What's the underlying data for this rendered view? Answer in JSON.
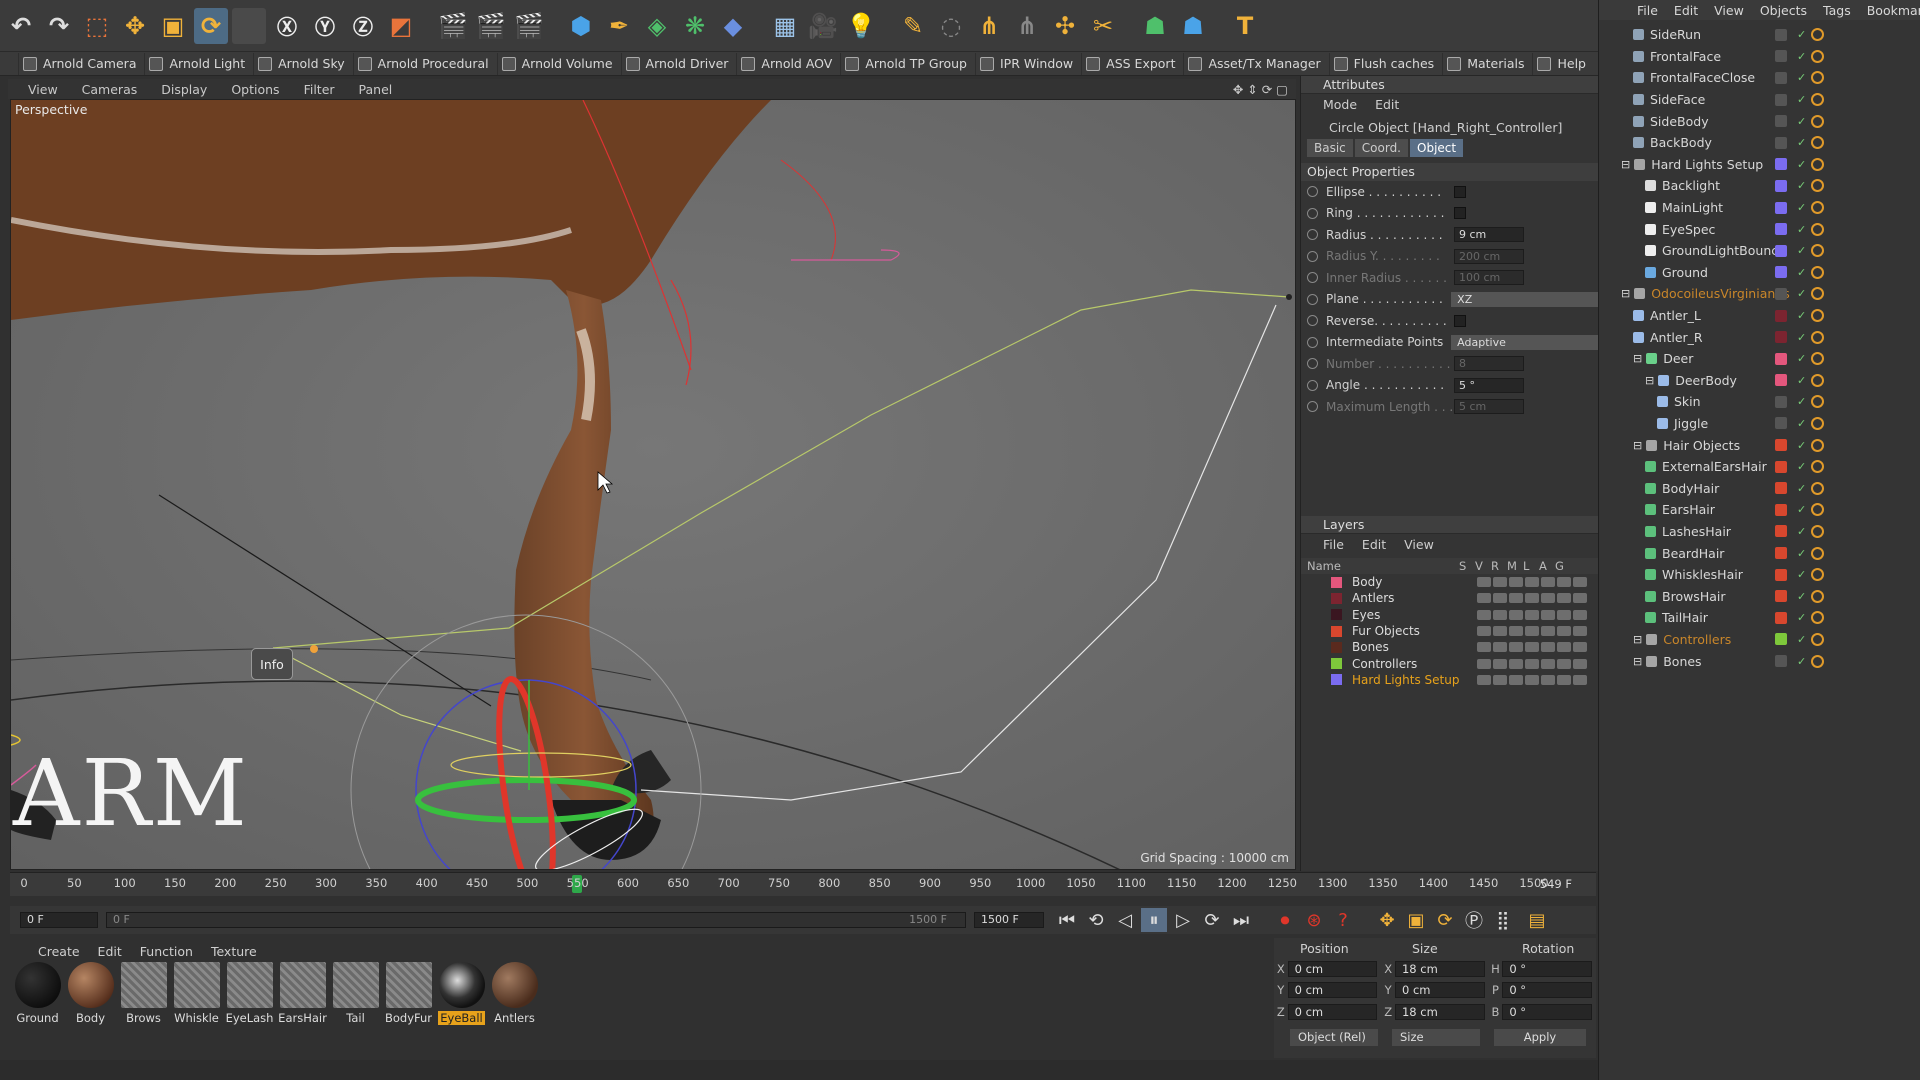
{
  "toolbar2": [
    "Arnold Camera",
    "Arnold Light",
    "Arnold Sky",
    "Arnold Procedural",
    "Arnold Volume",
    "Arnold Driver",
    "Arnold AOV",
    "Arnold TP Group",
    "IPR Window",
    "ASS Export",
    "Asset/Tx Manager",
    "Flush caches",
    "Materials",
    "Help"
  ],
  "viewport": {
    "menu": [
      "View",
      "Cameras",
      "Display",
      "Options",
      "Filter",
      "Panel"
    ],
    "label": "Perspective",
    "grid": "Grid Spacing : 10000 cm",
    "info": "Info",
    "watermark": "ARM"
  },
  "attributes": {
    "title": "Attributes",
    "menu": [
      "Mode",
      "Edit"
    ],
    "object": "Circle Object [Hand_Right_Controller]",
    "tabs": [
      "Basic",
      "Coord.",
      "Object"
    ],
    "section": "Object Properties",
    "props": [
      {
        "label": "Ellipse . . . . . . . . . .",
        "kind": "cb"
      },
      {
        "label": "Ring . . . . . . . . . . . .",
        "kind": "cb"
      },
      {
        "label": "Radius . . . . . . . . . .",
        "kind": "val",
        "value": "9 cm"
      },
      {
        "label": "Radius Y. . . . . . . . .",
        "kind": "val",
        "value": "200 cm",
        "dim": true
      },
      {
        "label": "Inner Radius . . . . . .",
        "kind": "val",
        "value": "100 cm",
        "dim": true
      },
      {
        "label": "Plane . . . . . . . . . . .",
        "kind": "sel",
        "value": "XZ"
      },
      {
        "label": "Reverse. . . . . . . . . .",
        "kind": "cb"
      },
      {
        "label": "Intermediate Points",
        "kind": "sel",
        "value": "Adaptive"
      },
      {
        "label": "Number . . . . . . . . . .",
        "kind": "val",
        "value": "8",
        "dim": true
      },
      {
        "label": "Angle . . . . . . . . . . .",
        "kind": "val",
        "value": "5 °"
      },
      {
        "label": "Maximum Length . . .",
        "kind": "val",
        "value": "5 cm",
        "dim": true
      }
    ]
  },
  "layers": {
    "title": "Layers",
    "menu": [
      "File",
      "Edit",
      "View"
    ],
    "cols": [
      "Name",
      "S",
      "V",
      "R",
      "M",
      "L",
      "A",
      "G"
    ],
    "rows": [
      {
        "name": "Body",
        "color": "#e4577d"
      },
      {
        "name": "Antlers",
        "color": "#7c2430"
      },
      {
        "name": "Eyes",
        "color": "#3a1620"
      },
      {
        "name": "Fur Objects",
        "color": "#d8472e"
      },
      {
        "name": "Bones",
        "color": "#5a2a1e"
      },
      {
        "name": "Controllers",
        "color": "#7ec83b"
      },
      {
        "name": "Hard Lights Setup",
        "color": "#7b6cf0",
        "sel": true
      }
    ]
  },
  "objects": {
    "menu": [
      "File",
      "Edit",
      "View",
      "Objects",
      "Tags",
      "Bookmarks"
    ],
    "rows": [
      {
        "name": "SideRun",
        "indent": 1,
        "c": "#8fa3b7"
      },
      {
        "name": "FrontalFace",
        "indent": 1,
        "c": "#8fa3b7"
      },
      {
        "name": "FrontalFaceClose",
        "indent": 1,
        "c": "#8fa3b7"
      },
      {
        "name": "SideFace",
        "indent": 1,
        "c": "#8fa3b7"
      },
      {
        "name": "SideBody",
        "indent": 1,
        "c": "#8fa3b7"
      },
      {
        "name": "BackBody",
        "indent": 1,
        "c": "#8fa3b7"
      },
      {
        "name": "Hard Lights Setup",
        "indent": 0,
        "c": "#a5a5a5",
        "g": "#7b6cf0"
      },
      {
        "name": "Backlight",
        "indent": 2,
        "c": "#ddd",
        "g": "#7b6cf0"
      },
      {
        "name": "MainLight",
        "indent": 2,
        "c": "#eee",
        "g": "#7b6cf0"
      },
      {
        "name": "EyeSpec",
        "indent": 2,
        "c": "#eee",
        "g": "#7b6cf0"
      },
      {
        "name": "GroundLightBounce",
        "indent": 2,
        "c": "#eee",
        "g": "#7b6cf0"
      },
      {
        "name": "Ground",
        "indent": 2,
        "c": "#6aa9e0",
        "g": "#7b6cf0"
      },
      {
        "name": "OdocoileusVirginianus",
        "indent": 0,
        "c": "#a5a5a5",
        "orange": true
      },
      {
        "name": "Antler_L",
        "indent": 1,
        "c": "#9bbbe8",
        "g": "#7c2430"
      },
      {
        "name": "Antler_R",
        "indent": 1,
        "c": "#9bbbe8",
        "g": "#7c2430"
      },
      {
        "name": "Deer",
        "indent": 1,
        "c": "#6ad08a",
        "g": "#e4577d"
      },
      {
        "name": "DeerBody",
        "indent": 2,
        "c": "#9bbbe8",
        "g": "#e4577d"
      },
      {
        "name": "Skin",
        "indent": 3,
        "c": "#9bbbe8"
      },
      {
        "name": "Jiggle",
        "indent": 3,
        "c": "#9bbbe8"
      },
      {
        "name": "Hair Objects",
        "indent": 1,
        "c": "#a5a5a5",
        "g": "#d8472e"
      },
      {
        "name": "ExternalEarsHair",
        "indent": 2,
        "c": "#5cc07c",
        "g": "#d8472e"
      },
      {
        "name": "BodyHair",
        "indent": 2,
        "c": "#5cc07c",
        "g": "#d8472e"
      },
      {
        "name": "EarsHair",
        "indent": 2,
        "c": "#5cc07c",
        "g": "#d8472e"
      },
      {
        "name": "LashesHair",
        "indent": 2,
        "c": "#5cc07c",
        "g": "#d8472e"
      },
      {
        "name": "BeardHair",
        "indent": 2,
        "c": "#5cc07c",
        "g": "#d8472e"
      },
      {
        "name": "WhisklesHair",
        "indent": 2,
        "c": "#5cc07c",
        "g": "#d8472e"
      },
      {
        "name": "BrowsHair",
        "indent": 2,
        "c": "#5cc07c",
        "g": "#d8472e"
      },
      {
        "name": "TailHair",
        "indent": 2,
        "c": "#5cc07c",
        "g": "#d8472e"
      },
      {
        "name": "Controllers",
        "indent": 1,
        "c": "#a5a5a5",
        "g": "#7ec83b",
        "orange": true
      },
      {
        "name": "Bones",
        "indent": 1,
        "c": "#a5a5a5"
      }
    ]
  },
  "timeline": {
    "ticks": [
      "0",
      "50",
      "100",
      "150",
      "200",
      "250",
      "300",
      "350",
      "400",
      "450",
      "500",
      "550",
      "600",
      "650",
      "700",
      "750",
      "800",
      "850",
      "900",
      "950",
      "1000",
      "1050",
      "1100",
      "1150",
      "1200",
      "1250",
      "1300",
      "1350",
      "1400",
      "1450",
      "1500"
    ],
    "current": "549 F",
    "start": "0 F",
    "range_start": "0 F",
    "range_end": "1500 F",
    "end": "1500 F"
  },
  "materials": {
    "menu": [
      "Create",
      "Edit",
      "Function",
      "Texture"
    ],
    "items": [
      {
        "name": "Ground",
        "type": "black"
      },
      {
        "name": "Body",
        "type": "brown"
      },
      {
        "name": "Brows",
        "type": "stripe"
      },
      {
        "name": "Whiskle",
        "type": "stripe"
      },
      {
        "name": "EyeLash",
        "type": "stripe"
      },
      {
        "name": "EarsHair",
        "type": "stripe"
      },
      {
        "name": "Tail",
        "type": "stripe"
      },
      {
        "name": "BodyFur",
        "type": "stripe"
      },
      {
        "name": "EyeBall",
        "type": "eye",
        "sel": true
      },
      {
        "name": "Antlers",
        "type": "antler"
      }
    ]
  },
  "coords": {
    "headers": [
      "Position",
      "Size",
      "Rotation"
    ],
    "rows": [
      {
        "a": "X",
        "p": "0 cm",
        "b": "X",
        "s": "18 cm",
        "c": "H",
        "r": "0 °"
      },
      {
        "a": "Y",
        "p": "0 cm",
        "b": "Y",
        "s": "0 cm",
        "c": "P",
        "r": "0 °"
      },
      {
        "a": "Z",
        "p": "0 cm",
        "b": "Z",
        "s": "18 cm",
        "c": "B",
        "r": "0 °"
      }
    ],
    "mode": "Object (Rel)",
    "size": "Size",
    "apply": "Apply"
  }
}
